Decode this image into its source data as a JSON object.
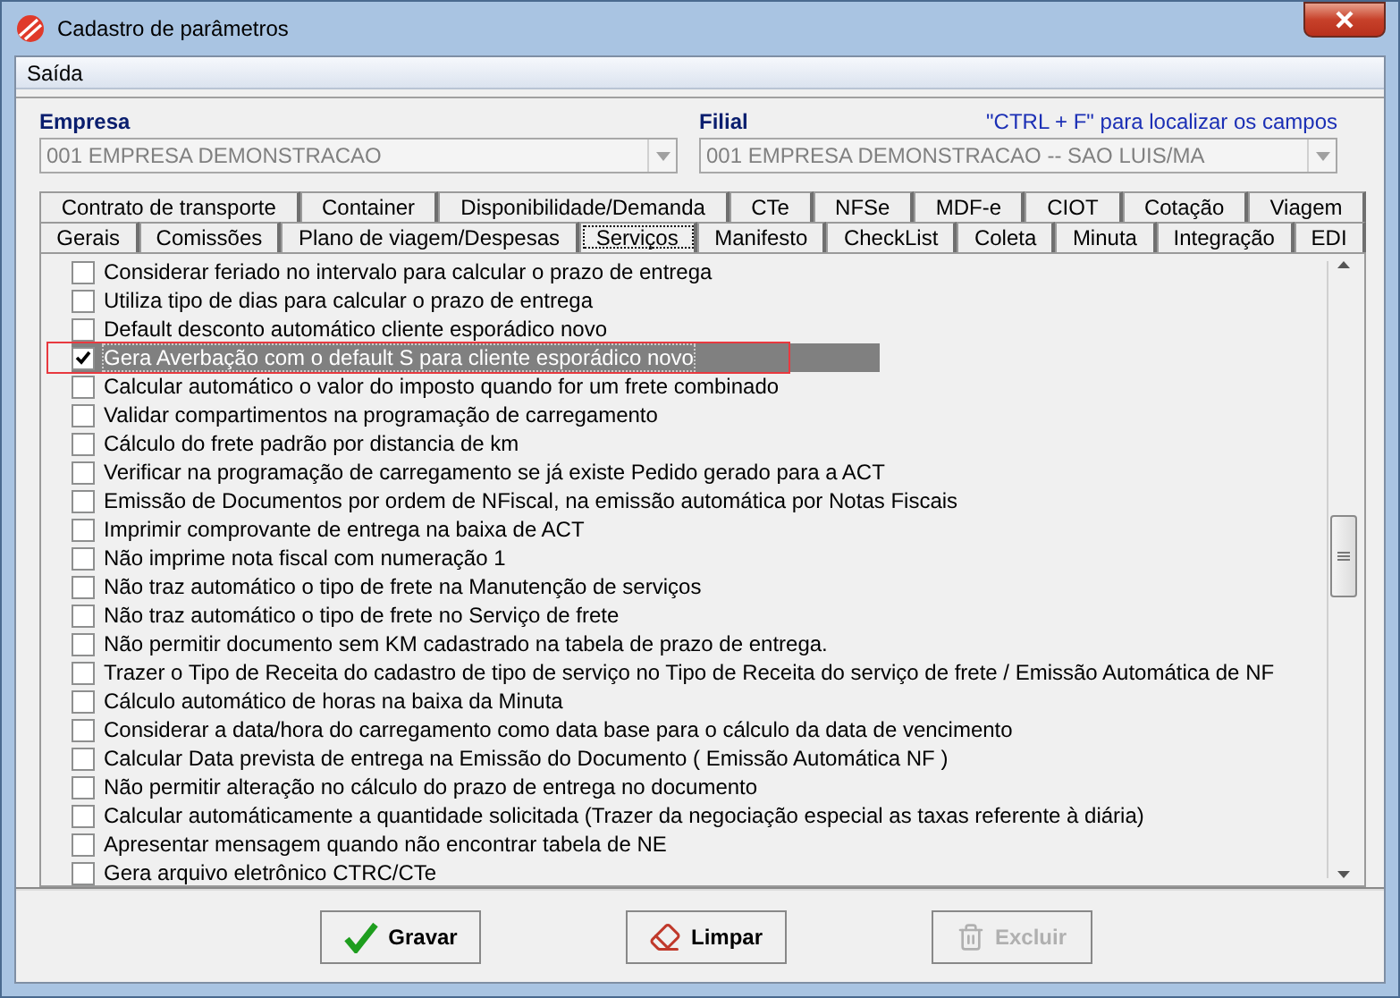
{
  "window": {
    "title": "Cadastro de parâmetros"
  },
  "menu": [
    {
      "label": "Saída"
    }
  ],
  "empresa": {
    "label": "Empresa",
    "value": "001 EMPRESA DEMONSTRACAO",
    "disabled": true
  },
  "filial": {
    "label": "Filial",
    "value": "001 EMPRESA DEMONSTRACAO -- SAO LUIS/MA",
    "disabled": true,
    "hint": "\"CTRL + F\" para localizar os campos"
  },
  "tab_rows": [
    [
      {
        "label": "Contrato de transporte",
        "selected": false
      },
      {
        "label": "Container",
        "selected": false
      },
      {
        "label": "Disponibilidade/Demanda",
        "selected": false
      },
      {
        "label": "CTe",
        "selected": false
      },
      {
        "label": "NFSe",
        "selected": false
      },
      {
        "label": "MDF-e",
        "selected": false
      },
      {
        "label": "CIOT",
        "selected": false
      },
      {
        "label": "Cotação",
        "selected": false
      },
      {
        "label": "Viagem",
        "selected": false
      }
    ],
    [
      {
        "label": "Gerais",
        "selected": false
      },
      {
        "label": "Comissões",
        "selected": false
      },
      {
        "label": "Plano de viagem/Despesas",
        "selected": false
      },
      {
        "label": "Serviços",
        "selected": true
      },
      {
        "label": "Manifesto",
        "selected": false
      },
      {
        "label": "CheckList",
        "selected": false
      },
      {
        "label": "Coleta",
        "selected": false
      },
      {
        "label": "Minuta",
        "selected": false
      },
      {
        "label": "Integração",
        "selected": false
      },
      {
        "label": "EDI",
        "selected": false
      }
    ]
  ],
  "options": [
    {
      "label": "Considerar feriado no intervalo para calcular o prazo de entrega",
      "checked": false,
      "selected": false,
      "annotated": false
    },
    {
      "label": "Utiliza tipo de dias para calcular o prazo de entrega",
      "checked": false,
      "selected": false,
      "annotated": false
    },
    {
      "label": "Default desconto automático cliente esporádico novo",
      "checked": false,
      "selected": false,
      "annotated": false
    },
    {
      "label": "Gera Averbação com o default S para cliente esporádico novo",
      "checked": true,
      "selected": true,
      "annotated": true
    },
    {
      "label": "Calcular automático o valor do imposto quando for um frete combinado",
      "checked": false,
      "selected": false,
      "annotated": false
    },
    {
      "label": "Validar compartimentos na programação de carregamento",
      "checked": false,
      "selected": false,
      "annotated": false
    },
    {
      "label": "Cálculo do frete padrão por distancia de km",
      "checked": false,
      "selected": false,
      "annotated": false
    },
    {
      "label": "Verificar na programação de carregamento se já existe Pedido gerado para a ACT",
      "checked": false,
      "selected": false,
      "annotated": false
    },
    {
      "label": "Emissão de Documentos por ordem de NFiscal, na emissão automática por Notas Fiscais",
      "checked": false,
      "selected": false,
      "annotated": false
    },
    {
      "label": "Imprimir comprovante de entrega na baixa de ACT",
      "checked": false,
      "selected": false,
      "annotated": false
    },
    {
      "label": "Não imprime nota fiscal com numeração 1",
      "checked": false,
      "selected": false,
      "annotated": false
    },
    {
      "label": "Não traz automático o tipo de frete na Manutenção de serviços",
      "checked": false,
      "selected": false,
      "annotated": false
    },
    {
      "label": "Não traz automático o tipo de frete no Serviço de frete",
      "checked": false,
      "selected": false,
      "annotated": false
    },
    {
      "label": "Não permitir documento sem KM cadastrado na tabela de prazo de entrega.",
      "checked": false,
      "selected": false,
      "annotated": false
    },
    {
      "label": "Trazer o Tipo de Receita do cadastro de tipo de serviço no Tipo de Receita do serviço de frete / Emissão Automática de NF",
      "checked": false,
      "selected": false,
      "annotated": false
    },
    {
      "label": "Cálculo automático de horas na baixa da Minuta",
      "checked": false,
      "selected": false,
      "annotated": false
    },
    {
      "label": "Considerar a data/hora do carregamento como data base para o cálculo da data de vencimento",
      "checked": false,
      "selected": false,
      "annotated": false
    },
    {
      "label": "Calcular Data prevista de entrega na Emissão do Documento ( Emissão Automática NF )",
      "checked": false,
      "selected": false,
      "annotated": false
    },
    {
      "label": "Não permitir alteração no cálculo do prazo de entrega no documento",
      "checked": false,
      "selected": false,
      "annotated": false
    },
    {
      "label": "Calcular automáticamente a quantidade solicitada (Trazer da negociação especial as taxas referente à diária)",
      "checked": false,
      "selected": false,
      "annotated": false
    },
    {
      "label": "Apresentar mensagem quando não encontrar tabela de NE",
      "checked": false,
      "selected": false,
      "annotated": false
    },
    {
      "label": "Gera arquivo eletrônico CTRC/CTe",
      "checked": false,
      "selected": false,
      "annotated": false
    }
  ],
  "buttons": [
    {
      "label": "Gravar",
      "kind": "save",
      "disabled": false
    },
    {
      "label": "Limpar",
      "kind": "clear",
      "disabled": false
    },
    {
      "label": "Excluir",
      "kind": "delete",
      "disabled": true
    }
  ]
}
